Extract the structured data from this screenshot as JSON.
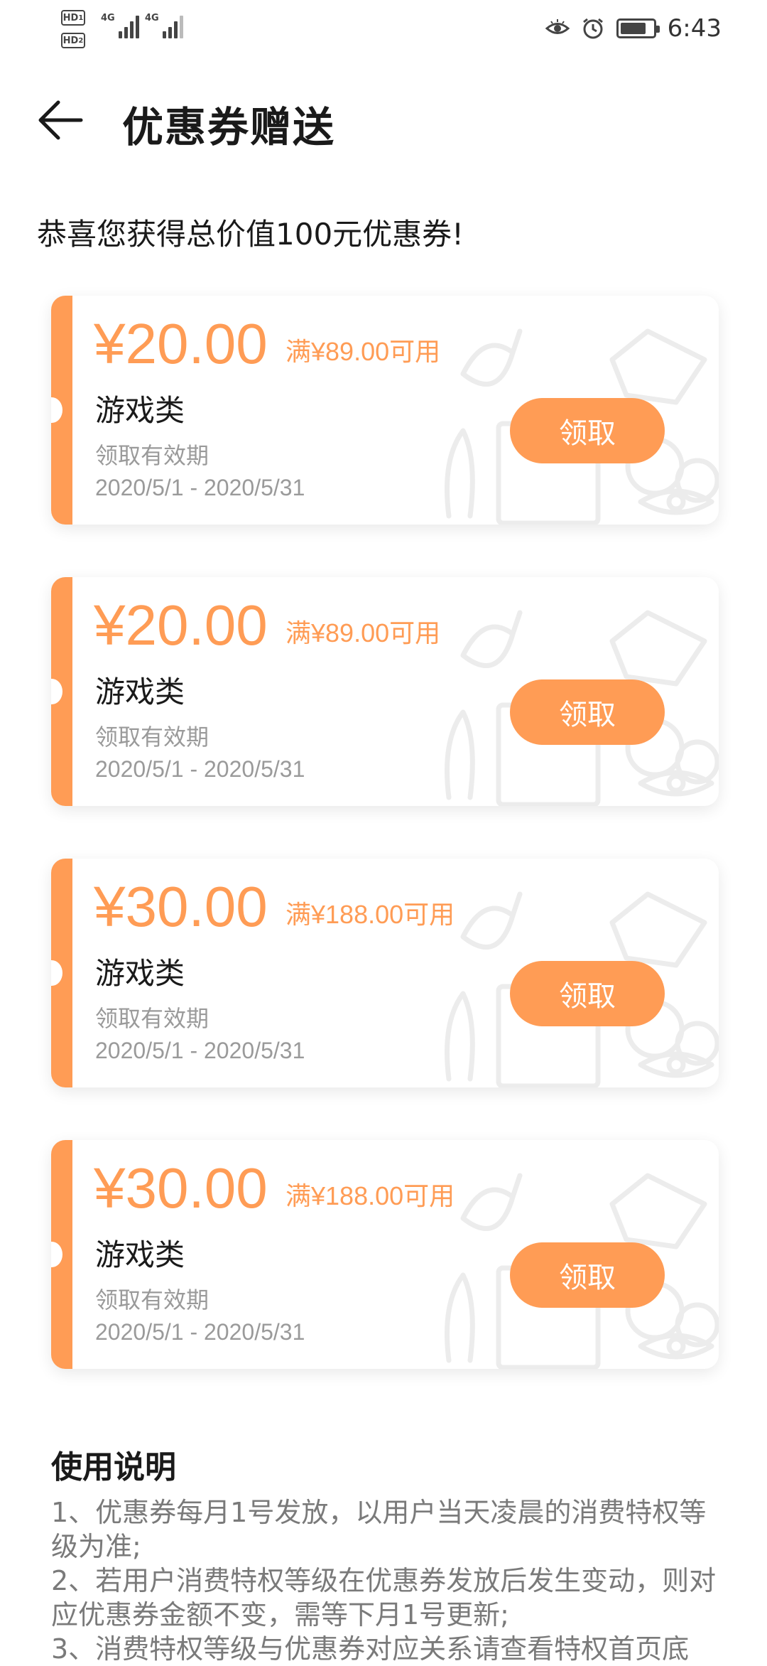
{
  "status_bar": {
    "sim1": "HD",
    "sim1_index": "1",
    "sim2": "HD",
    "sim2_index": "2",
    "network1": "4G",
    "network2": "4G",
    "time": "6:43"
  },
  "header": {
    "title": "优惠券赠送"
  },
  "congrats_text": "恭喜您获得总价值100元优惠券!",
  "coupons": [
    {
      "amount": "¥20.00",
      "condition": "满¥89.00可用",
      "category": "游戏类",
      "valid_label": "领取有效期",
      "valid_range": "2020/5/1 - 2020/5/31",
      "button": "领取"
    },
    {
      "amount": "¥20.00",
      "condition": "满¥89.00可用",
      "category": "游戏类",
      "valid_label": "领取有效期",
      "valid_range": "2020/5/1 - 2020/5/31",
      "button": "领取"
    },
    {
      "amount": "¥30.00",
      "condition": "满¥188.00可用",
      "category": "游戏类",
      "valid_label": "领取有效期",
      "valid_range": "2020/5/1 - 2020/5/31",
      "button": "领取"
    },
    {
      "amount": "¥30.00",
      "condition": "满¥188.00可用",
      "category": "游戏类",
      "valid_label": "领取有效期",
      "valid_range": "2020/5/1 - 2020/5/31",
      "button": "领取"
    }
  ],
  "instructions": {
    "title": "使用说明",
    "items": [
      "1、优惠券每月1号发放，以用户当天凌晨的消费特权等级为准;",
      "2、若用户消费特权等级在优惠券发放后发生变动，则对应优惠券金额不变，需等下月1号更新;",
      "3、消费特权等级与优惠券对应关系请查看特权首页底"
    ]
  },
  "colors": {
    "accent": "#ff9c55",
    "text_primary": "#1a1a1a",
    "text_secondary": "#9a9a9a"
  }
}
